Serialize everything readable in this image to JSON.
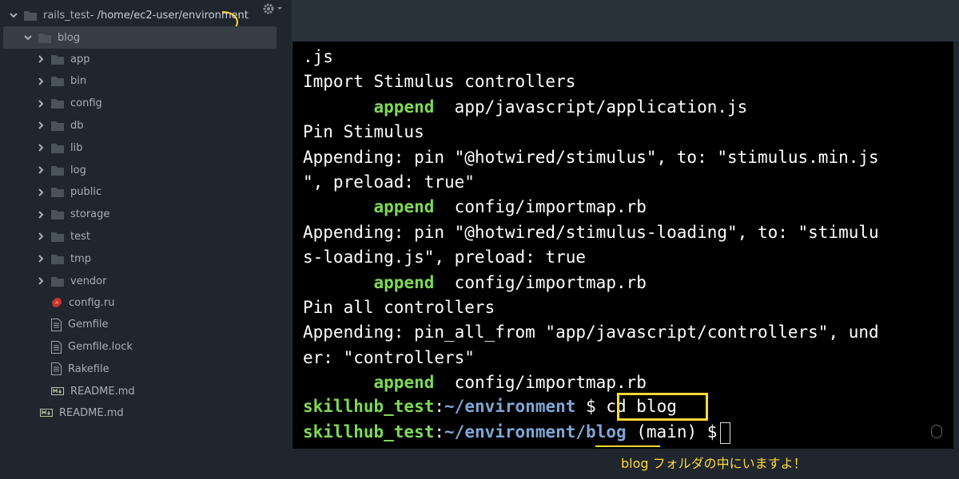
{
  "sidebar": {
    "root": {
      "name": "rails_test",
      "path": " - /home/ec2-user/environment"
    },
    "project": {
      "name": "blog"
    },
    "folders": [
      "app",
      "bin",
      "config",
      "db",
      "lib",
      "log",
      "public",
      "storage",
      "test",
      "tmp",
      "vendor"
    ],
    "files": [
      {
        "name": "config.ru",
        "icon": "ruby-icon"
      },
      {
        "name": "Gemfile",
        "icon": "file-icon"
      },
      {
        "name": "Gemfile.lock",
        "icon": "file-icon"
      },
      {
        "name": "Rakefile",
        "icon": "file-icon"
      },
      {
        "name": "README.md",
        "icon": "markdown-icon"
      }
    ],
    "root_files": [
      {
        "name": "README.md",
        "icon": "markdown-icon"
      }
    ]
  },
  "terminal": {
    "lines": [
      {
        "text": ".js"
      },
      {
        "text": "Import Stimulus controllers"
      },
      {
        "keyword": "append",
        "text": "app/javascript/application.js"
      },
      {
        "text": "Pin Stimulus"
      },
      {
        "text": "Appending: pin \"@hotwired/stimulus\", to: \"stimulus.min.js"
      },
      {
        "text": "\", preload: true\""
      },
      {
        "keyword": "append",
        "text": "config/importmap.rb"
      },
      {
        "text": "Appending: pin \"@hotwired/stimulus-loading\", to: \"stimulu"
      },
      {
        "text": "s-loading.js\", preload: true"
      },
      {
        "keyword": "append",
        "text": "config/importmap.rb"
      },
      {
        "text": "Pin all controllers"
      },
      {
        "text": "Appending: pin_all_from \"app/javascript/controllers\", und"
      },
      {
        "text": "er: \"controllers\""
      },
      {
        "keyword": "append",
        "text": "config/importmap.rb"
      }
    ],
    "prompt1": {
      "host": "skillhub_test",
      "path": "~/environment",
      "symbol": "$",
      "command": "cd blog"
    },
    "prompt2": {
      "host": "skillhub_test",
      "path": "~/environment/",
      "path_highlight": "blog",
      "branch": " (main)",
      "symbol": "$"
    }
  },
  "annotation": "blog フォルダの中にいますよ！",
  "colors": {
    "accent": "#ffd83a",
    "prompt_green": "#7ed957",
    "prompt_blue": "#7fa7d6"
  }
}
